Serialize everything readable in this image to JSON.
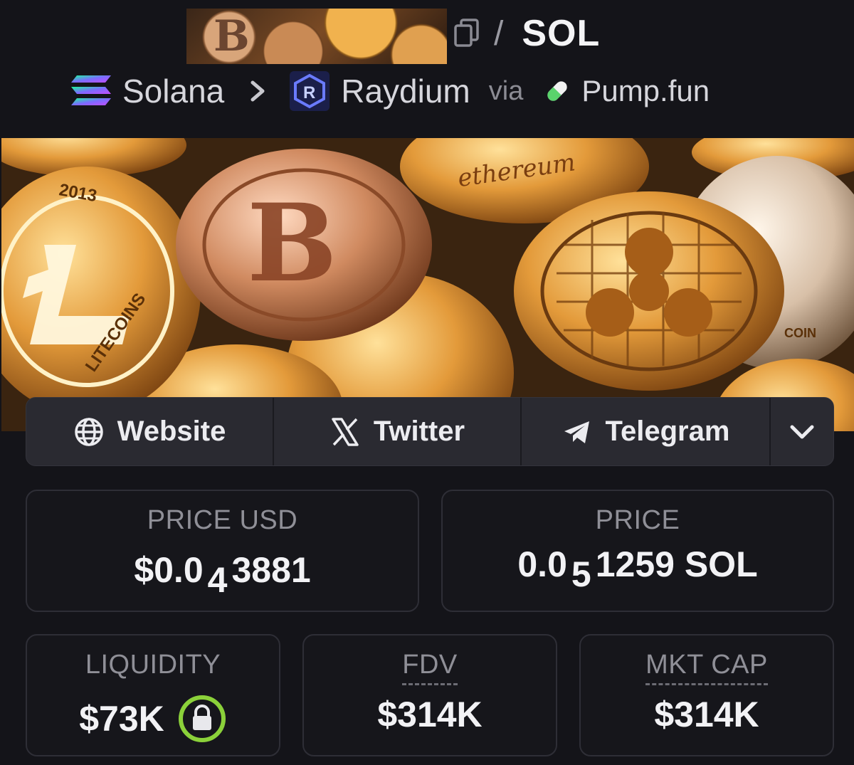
{
  "header": {
    "thumb_letter": "B",
    "separator": "/",
    "symbol": "SOL"
  },
  "chain": {
    "name": "Solana",
    "dex": "Raydium",
    "via_label": "via",
    "launchpad": "Pump.fun"
  },
  "banner": {
    "coin_text_ethereum": "ethereum",
    "coin_text_litecoins": "LITECOINS",
    "coin_text_year": "2013",
    "coin_text_coin": "COIN"
  },
  "links": {
    "website": "Website",
    "twitter": "Twitter",
    "telegram": "Telegram"
  },
  "stats": {
    "price_usd": {
      "label": "PRICE USD",
      "prefix": "$0.0",
      "zeros": "4",
      "digits": "3881"
    },
    "price": {
      "label": "PRICE",
      "prefix": "0.0",
      "zeros": "5",
      "digits": "1259 SOL"
    },
    "liquidity": {
      "label": "LIQUIDITY",
      "value": "$73K"
    },
    "fdv": {
      "label": "FDV",
      "value": "$314K"
    },
    "mkt_cap": {
      "label": "MKT CAP",
      "value": "$314K"
    }
  },
  "colors": {
    "background": "#141419",
    "card_border": "#2e2e36",
    "links_bar": "#2a2a31",
    "lock_ring": "#8bd13a",
    "solana_gradient": [
      "#9945ff",
      "#19fb9b"
    ],
    "raydium_blue": "#2b6bff",
    "pump_green": "#5ad36c"
  },
  "icons": [
    "copy-icon",
    "solana-icon",
    "chevron-right-icon",
    "raydium-icon",
    "pill-icon",
    "globe-icon",
    "x-icon",
    "telegram-icon",
    "chevron-down-icon",
    "lock-icon"
  ]
}
